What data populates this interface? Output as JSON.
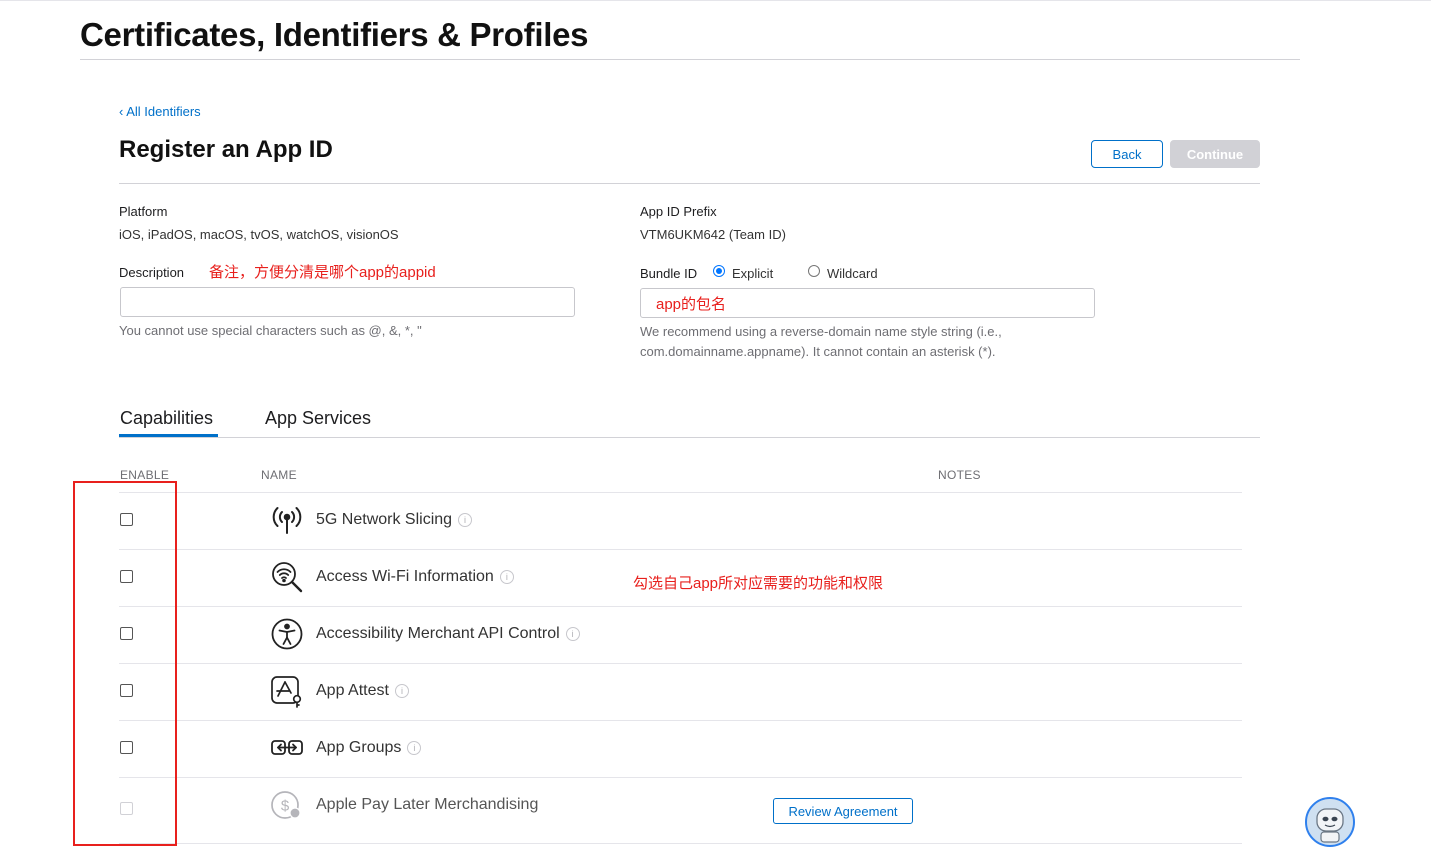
{
  "header": {
    "title": "Certificates, Identifiers & Profiles"
  },
  "nav": {
    "back_link": "‹ All Identifiers"
  },
  "section": {
    "title": "Register an App ID"
  },
  "actions": {
    "back_label": "Back",
    "continue_label": "Continue"
  },
  "platform": {
    "label": "Platform",
    "value": "iOS, iPadOS, macOS, tvOS, watchOS, visionOS"
  },
  "prefix": {
    "label": "App ID Prefix",
    "value": "VTM6UKM642 (Team ID)"
  },
  "description": {
    "label": "Description",
    "annotation": "备注，方便分清是哪个app的appid",
    "value": "",
    "hint": "You cannot use special characters such as @, &, *, \""
  },
  "bundle": {
    "label": "Bundle ID",
    "explicit_label": "Explicit",
    "wildcard_label": "Wildcard",
    "selected": "Explicit",
    "annotation": "app的包名",
    "hint_line1": "We recommend using a reverse-domain name style string (i.e.,",
    "hint_line2": "com.domainname.appname). It cannot contain an asterisk (*)."
  },
  "tabs": [
    {
      "label": "Capabilities",
      "active": true
    },
    {
      "label": "App Services",
      "active": false
    }
  ],
  "table": {
    "headers": {
      "enable": "ENABLE",
      "name": "NAME",
      "notes": "NOTES"
    },
    "annotation": "勾选自己app所对应需要的功能和权限",
    "rows": [
      {
        "name": "5G Network Slicing",
        "icon": "antenna-icon",
        "checked": false,
        "disabled": false
      },
      {
        "name": "Access Wi-Fi Information",
        "icon": "wifi-search-icon",
        "checked": false,
        "disabled": false
      },
      {
        "name": "Accessibility Merchant API Control",
        "icon": "accessibility-icon",
        "checked": false,
        "disabled": false
      },
      {
        "name": "App Attest",
        "icon": "app-attest-icon",
        "checked": false,
        "disabled": false
      },
      {
        "name": "App Groups",
        "icon": "app-groups-icon",
        "checked": false,
        "disabled": false
      },
      {
        "name": "Apple Pay Later Merchandising",
        "icon": "dollar-coin-icon",
        "checked": false,
        "disabled": true,
        "note_button": "Review Agreement"
      }
    ]
  },
  "colors": {
    "accent": "#0070c9",
    "annotation": "#e8201d",
    "disabled_button": "#d1d1d6"
  }
}
